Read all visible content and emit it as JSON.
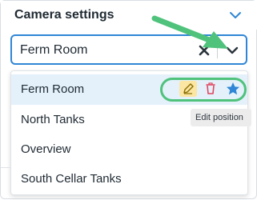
{
  "panel": {
    "title": "Camera settings"
  },
  "select": {
    "value": "Ferm Room"
  },
  "menu": {
    "items": [
      {
        "label": "Ferm Room",
        "selected": true
      },
      {
        "label": "North Tanks"
      },
      {
        "label": "Overview"
      },
      {
        "label": "South Cellar Tanks"
      }
    ]
  },
  "tooltip": {
    "text": "Edit position"
  },
  "icons": {
    "collapse": "chevron-down-icon",
    "clear": "close-icon",
    "dropdown": "chevron-down-icon",
    "edit": "pencil-icon",
    "delete": "trash-icon",
    "favorite": "star-icon",
    "annotation": "arrow-icon"
  },
  "colors": {
    "accent": "#2f86d6",
    "highlight_annotation": "#4fc27c",
    "selected_row": "#e4f1fb",
    "edit_bg": "#fbe6a3",
    "delete": "#e0465e",
    "star": "#2f86d6"
  }
}
